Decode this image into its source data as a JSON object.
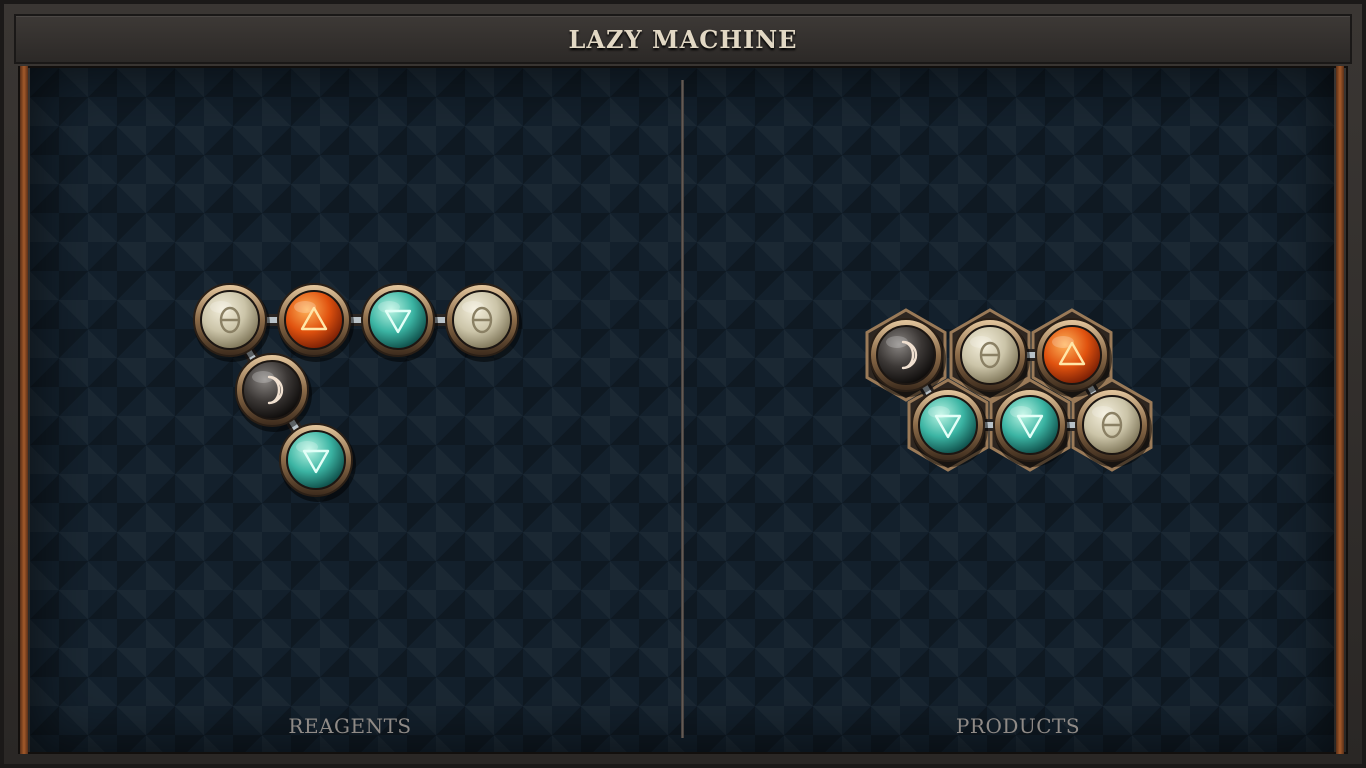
{
  "title": "LAZY MACHINE",
  "panels": {
    "reagents_label": "REAGENTS",
    "products_label": "PRODUCTS"
  },
  "atom_types": {
    "salt": {
      "symbol": "θ",
      "icon": "salt-symbol-icon",
      "colors": [
        "#f3eedb",
        "#cbc4a8",
        "#7f7659"
      ],
      "glyph": "#8a8064"
    },
    "fire": {
      "symbol": "△",
      "icon": "fire-symbol-icon",
      "colors": [
        "#ffb35a",
        "#e0520f",
        "#7a1f05"
      ],
      "glyph": "#ffe6a8"
    },
    "water": {
      "symbol": "▽",
      "icon": "water-symbol-icon",
      "colors": [
        "#b9f5e3",
        "#3bb4a3",
        "#0f4f4a"
      ],
      "glyph": "#e2fff7"
    },
    "vitae": {
      "symbol": "☽",
      "icon": "moon-symbol-icon",
      "colors": [
        "#8a8683",
        "#3b3735",
        "#0e0c0b"
      ],
      "glyph": "#f0e0d0"
    }
  },
  "reagent": {
    "atoms": [
      "salt",
      "fire",
      "water",
      "salt",
      "vitae",
      "water"
    ],
    "bonds": [
      [
        0,
        1
      ],
      [
        1,
        2
      ],
      [
        2,
        3
      ],
      [
        0,
        4
      ],
      [
        4,
        5
      ]
    ]
  },
  "product": {
    "atoms": [
      "vitae",
      "salt",
      "fire",
      "water",
      "water",
      "salt"
    ],
    "bonds": [
      [
        1,
        2
      ],
      [
        0,
        3
      ],
      [
        3,
        4
      ],
      [
        4,
        5
      ],
      [
        2,
        5
      ]
    ]
  }
}
